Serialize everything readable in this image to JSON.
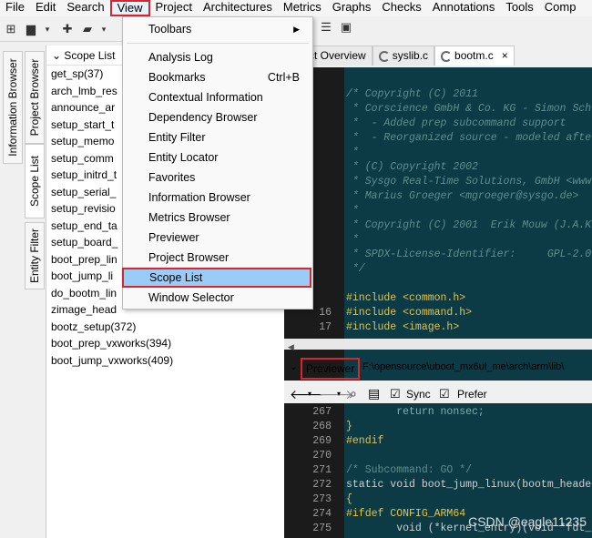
{
  "menubar": [
    "File",
    "Edit",
    "Search",
    "View",
    "Project",
    "Architectures",
    "Metrics",
    "Graphs",
    "Checks",
    "Annotations",
    "Tools",
    "Comp"
  ],
  "side_tabs": {
    "info": "Information Browser",
    "project": "Project Browser",
    "scope": "Scope List",
    "entity": "Entity Filter"
  },
  "scope": {
    "title": "Scope List",
    "items": [
      "get_sp(37)",
      "arch_lmb_res",
      "announce_ar",
      "setup_start_t",
      "setup_memo",
      "setup_comm",
      "setup_initrd_t",
      "setup_serial_",
      "setup_revisio",
      "setup_end_ta",
      "setup_board_",
      "boot_prep_lin",
      "boot_jump_li",
      "do_bootm_lin",
      "zimage_head",
      "bootz_setup(372)",
      "boot_prep_vxworks(394)",
      "boot_jump_vxworks(409)"
    ]
  },
  "file_tabs": [
    "roject Overview",
    "syslib.c",
    "bootm.c"
  ],
  "view_menu": {
    "items": [
      "Toolbars",
      "Analysis Log",
      "Bookmarks",
      "Contextual Information",
      "Dependency Browser",
      "Entity Filter",
      "Entity Locator",
      "Favorites",
      "Information Browser",
      "Metrics Browser",
      "Previewer",
      "Project Browser",
      "Scope List",
      "Window Selector"
    ],
    "shortcut": "Ctrl+B"
  },
  "previewer": {
    "label": "Previewer",
    "path": "F:\\opensource\\uboot_mx6ul_me\\arch\\arm\\lib\\",
    "sync": "Sync",
    "prefer": "Prefer"
  },
  "code_top": [
    {
      "n": "",
      "t": "/* Copyright (C) 2011",
      "c": "#5f8f8f",
      "i": true
    },
    {
      "n": "",
      "t": " * Corscience GmbH & Co. KG - Simon Sch",
      "c": "#5f8f8f",
      "i": true
    },
    {
      "n": "",
      "t": " *  - Added prep subcommand support",
      "c": "#5f8f8f",
      "i": true
    },
    {
      "n": "",
      "t": " *  - Reorganized source - modeled afte",
      "c": "#5f8f8f",
      "i": true
    },
    {
      "n": "",
      "t": " *",
      "c": "#5f8f8f",
      "i": true
    },
    {
      "n": "",
      "t": " * (C) Copyright 2002",
      "c": "#5f8f8f",
      "i": true
    },
    {
      "n": "",
      "t": " * Sysgo Real-Time Solutions, GmbH <www",
      "c": "#5f8f8f",
      "i": true
    },
    {
      "n": "",
      "t": " * Marius Groeger <mgroeger@sysgo.de>",
      "c": "#5f8f8f",
      "i": true
    },
    {
      "n": "",
      "t": " *",
      "c": "#5f8f8f",
      "i": true
    },
    {
      "n": "",
      "t": " * Copyright (C) 2001  Erik Mouw (J.A.K",
      "c": "#5f8f8f",
      "i": true
    },
    {
      "n": "",
      "t": " *",
      "c": "#5f8f8f",
      "i": true
    },
    {
      "n": "",
      "t": " * SPDX-License-Identifier:     GPL-2.0",
      "c": "#5f8f8f",
      "i": true
    },
    {
      "n": "",
      "t": " */",
      "c": "#5f8f8f",
      "i": true
    },
    {
      "n": "",
      "t": "",
      "c": "#fff",
      "i": false
    },
    {
      "n": "",
      "t": "#include <common.h>",
      "c": "#e6c34a",
      "i": false
    },
    {
      "n": "16",
      "t": "#include <command.h>",
      "c": "#e6c34a",
      "i": false
    },
    {
      "n": "17",
      "t": "#include <image.h>",
      "c": "#e6c34a",
      "i": false
    }
  ],
  "code_bottom": [
    {
      "n": "267",
      "t": "        return nonsec;",
      "c": "#7fb0b0"
    },
    {
      "n": "268",
      "t": "}",
      "c": "#e6c34a"
    },
    {
      "n": "269",
      "t": "#endif",
      "c": "#e6c34a"
    },
    {
      "n": "270",
      "t": "",
      "c": "#fff"
    },
    {
      "n": "271",
      "t": "/* Subcommand: GO */",
      "c": "#5f8f8f"
    },
    {
      "n": "272",
      "t": "static void boot_jump_linux(bootm_heade",
      "c": "#d0d0d0"
    },
    {
      "n": "273",
      "t": "{",
      "c": "#e6c34a"
    },
    {
      "n": "274",
      "t": "#ifdef CONFIG_ARM64",
      "c": "#e6c34a"
    },
    {
      "n": "275",
      "t": "        void (*kernel_entry)(void *fdt_",
      "c": "#d0d0d0"
    }
  ],
  "watermark": "CSDN @eagle11235"
}
